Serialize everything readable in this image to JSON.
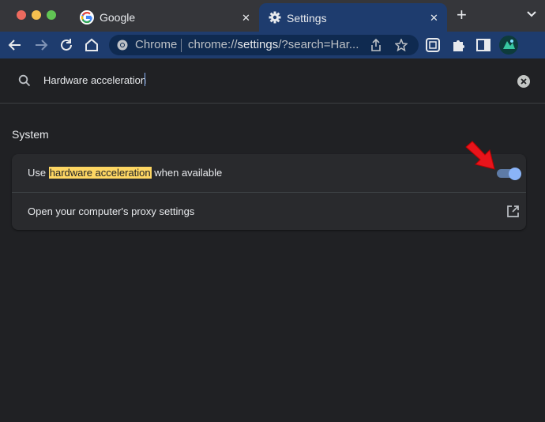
{
  "tabs": [
    {
      "title": "Google",
      "icon": "google-icon",
      "active": false
    },
    {
      "title": "Settings",
      "icon": "gear-icon",
      "active": true
    }
  ],
  "omnibox": {
    "site_chip": "Chrome",
    "url_prefix": "chrome://",
    "url_host": "settings",
    "url_rest": "/?search=Har..."
  },
  "search": {
    "query": "Hardware acceleration"
  },
  "section": {
    "title": "System"
  },
  "settings_rows": {
    "hardware": {
      "prefix": "Use ",
      "highlight": "hardware acceleration",
      "suffix": " when available",
      "enabled": true
    },
    "proxy": {
      "label": "Open your computer's proxy settings"
    }
  },
  "colors": {
    "accent_blue": "#8ab4f8",
    "highlight_yellow": "#fdd663",
    "toolbar_blue": "#1e3c6e",
    "annotation_arrow": "#e8141b"
  }
}
